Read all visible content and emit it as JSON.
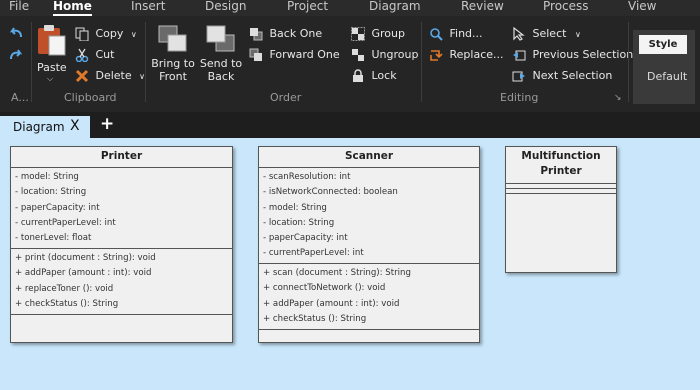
{
  "menu": {
    "tabs": [
      "File",
      "Home",
      "Insert",
      "Design",
      "Project",
      "Diagram",
      "Review",
      "Process",
      "View"
    ],
    "active": "Home"
  },
  "ribbon": {
    "clipboard": {
      "label": "Clipboard",
      "paste": "Paste",
      "copy": "Copy",
      "cut": "Cut",
      "delete": "Delete",
      "more": "A..."
    },
    "order": {
      "label": "Order",
      "bring_to_front": [
        "Bring to",
        "Front"
      ],
      "send_to_back": [
        "Send to",
        "Back"
      ],
      "back_one": "Back One",
      "forward_one": "Forward One",
      "group": "Group",
      "ungroup": "Ungroup",
      "lock": "Lock"
    },
    "editing": {
      "label": "Editing",
      "find": "Find...",
      "replace": "Replace...",
      "select": "Select",
      "previous_selection": "Previous Selection",
      "next_selection": "Next Selection"
    },
    "style": {
      "style_button": "Style",
      "default": "Default"
    }
  },
  "document_tab": {
    "title": "Diagram",
    "close": "X",
    "new": "+"
  },
  "colors": {
    "canvas": "#c9e6fb",
    "ribbon": "#252525",
    "class_fill": "#f0f0f0",
    "delete_icon": "#e07a2a"
  },
  "classes": [
    {
      "name": "Printer",
      "attributes": [
        "- model: String",
        "- location: String",
        "- paperCapacity: int",
        "- currentPaperLevel: int",
        "- tonerLevel: float"
      ],
      "methods": [
        "+ print (document : String): void",
        "+ addPaper (amount : int): void",
        "+ replaceToner (): void",
        "+ checkStatus (): String"
      ]
    },
    {
      "name": "Scanner",
      "attributes": [
        "- scanResolution: int",
        "- isNetworkConnected: boolean",
        "- model: String",
        "- location: String",
        "- paperCapacity: int",
        "- currentPaperLevel: int"
      ],
      "methods": [
        "+ scan (document : String): String",
        "+ connectToNetwork (): void",
        "+ addPaper (amount : int): void",
        "+ checkStatus (): String"
      ]
    },
    {
      "name": "Multifunction Printer",
      "attributes": [],
      "methods": []
    }
  ]
}
